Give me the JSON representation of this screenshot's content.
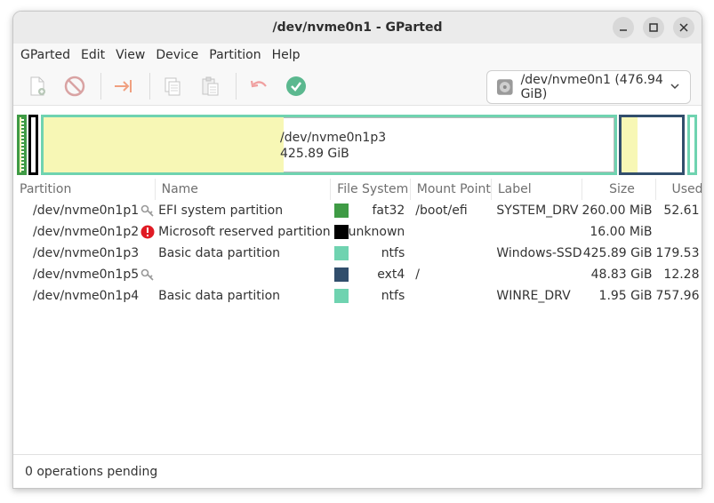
{
  "window": {
    "title": "/dev/nvme0n1 - GParted"
  },
  "menu": [
    "GParted",
    "Edit",
    "View",
    "Device",
    "Partition",
    "Help"
  ],
  "toolbar": {
    "buttons": [
      "new-partition",
      "delete",
      "resize-move",
      "copy",
      "paste",
      "undo",
      "apply"
    ],
    "device_label": "/dev/nvme0n1 (476.94 GiB)"
  },
  "diskmap": {
    "selected_name": "/dev/nvme0n1p3",
    "selected_size": "425.89 GiB"
  },
  "table": {
    "headers": [
      "Partition",
      "Name",
      "File System",
      "Mount Point",
      "Label",
      "Size",
      "Used"
    ],
    "rows": [
      {
        "partition": "/dev/nvme0n1p1",
        "icon": "key-icon",
        "name": "EFI system partition",
        "fs": "fat32",
        "fs_color": "#3f9b45",
        "mount": "/boot/efi",
        "label": "SYSTEM_DRV",
        "size": "260.00 MiB",
        "used": "52.61"
      },
      {
        "partition": "/dev/nvme0n1p2",
        "icon": "warning-icon",
        "name": "Microsoft reserved partition",
        "fs": "unknown",
        "fs_color": "#000000",
        "mount": "",
        "label": "",
        "size": "16.00 MiB",
        "used": ""
      },
      {
        "partition": "/dev/nvme0n1p3",
        "icon": "",
        "name": "Basic data partition",
        "fs": "ntfs",
        "fs_color": "#6fd3b0",
        "mount": "",
        "label": "Windows-SSD",
        "size": "425.89 GiB",
        "used": "179.53"
      },
      {
        "partition": "/dev/nvme0n1p5",
        "icon": "key-icon",
        "name": "",
        "fs": "ext4",
        "fs_color": "#314e6c",
        "mount": "/",
        "label": "",
        "size": "48.83 GiB",
        "used": "12.28"
      },
      {
        "partition": "/dev/nvme0n1p4",
        "icon": "",
        "name": "Basic data partition",
        "fs": "ntfs",
        "fs_color": "#6fd3b0",
        "mount": "",
        "label": "WINRE_DRV",
        "size": "1.95 GiB",
        "used": "757.96"
      }
    ]
  },
  "status": {
    "text": "0 operations pending"
  },
  "colors": {
    "ntfs": "#6fd3b0",
    "ext4": "#314e6c",
    "fat32": "#3f9b45",
    "used": "#f7f7b5"
  }
}
